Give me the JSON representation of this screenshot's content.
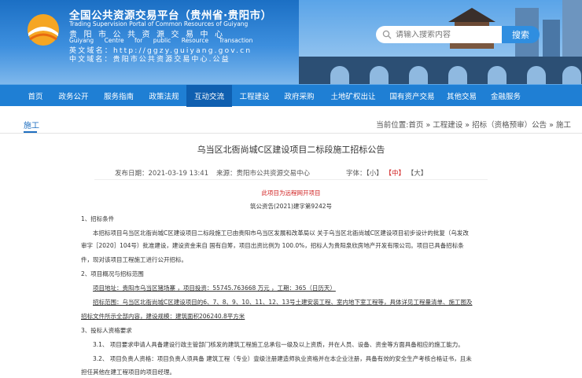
{
  "header": {
    "title": "全国公共资源交易平台（贵州省·贵阳市）",
    "subtitle": "Trading Supervision Portal of Common Resources of Guiyang",
    "name_cn": "贵阳市公共资源交易中心",
    "name_en": "Guiyang Centre for public Resource Transaction",
    "domain_en": "英文域名：http://ggzy.guiyang.gov.cn",
    "domain_cn": "中文域名：贵阳市公共资源交易中心.公益",
    "search_placeholder": "请输入搜索内容",
    "search_button": "搜索"
  },
  "nav": [
    "首页",
    "政务公开",
    "服务指南",
    "政策法规",
    "互动交流",
    "工程建设",
    "政府采购",
    "土地矿权出让",
    "国有资产交易",
    "其他交易",
    "金融服务"
  ],
  "nav_active": 4,
  "section": "施工",
  "breadcrumb": "当前位置:首页 » 工程建设 » 招标（资格预审）公告 » 施工",
  "doc": {
    "title": "乌当区北衙尚城C区建设项目二标段施工招标公告",
    "date": "发布日期：2021-03-19 13:41",
    "source": "来源：贵阳市公共资源交易中心",
    "font_label": "字体：",
    "font_small": "【小】",
    "font_mid": "【中】",
    "font_large": "【大】",
    "notice": "此项目为远程网开项目",
    "doc_no": "筑公资告(2021)建字第9242号",
    "s1": "1、招标条件",
    "s1_line1": "本招标项目乌当区北衙尚城C区建设项目二标段施工已由贵阳市乌当区发展和改革局以 关于乌当区北衙尚城C区建设项目初步设计的批复（乌发改",
    "s1_line2": "审字［2020］104号）批准建设，建设资金来自 国有自筹，项目出资比例为 100.0%，招标人为贵阳泉欣房地产开发有限公司。项目已具备招标条",
    "s1_line3": "件，现对该项目工程施工进行公开招标。",
    "s2": "2、项目概况与招标范围",
    "s2_line1": "项目地址：贵阳市乌当区猪场寨 ，项目投资：55745.763668 万元 ，工期：365（日历天）",
    "s2_line2": "招标范围：乌当区北衙尚城C区建设项目的6、7、8、9、10、11、12、13号土建安装工程、室内地下室工程等，具体详见工程量清单、施工图及",
    "s2_line3": "招标文件所示全部内容，建设规模：建筑面积206240.8平方米",
    "s3": "3、投标人资格要求",
    "s3_line1": "3.1、 项目要求申请人具备建设行政主管部门核发的建筑工程施工总承包一级及以上资质，并在人员、设备、资金等方面具备相应的施工能力。",
    "s3_line2": "3.2、 项目负责人资格：项目负责人须具备 建筑工程（专业）壹级注册建造师执业资格并在本企业注册，具备有效的安全生产考核合格证书，且未",
    "s3_line3": "担任其他在建工程项目的项目经理。"
  },
  "colors": {
    "nav_bg": "#1f7fd4",
    "nav_active": "#0f5fb0",
    "accent": "#1f6fc0",
    "red": "#d02020"
  }
}
